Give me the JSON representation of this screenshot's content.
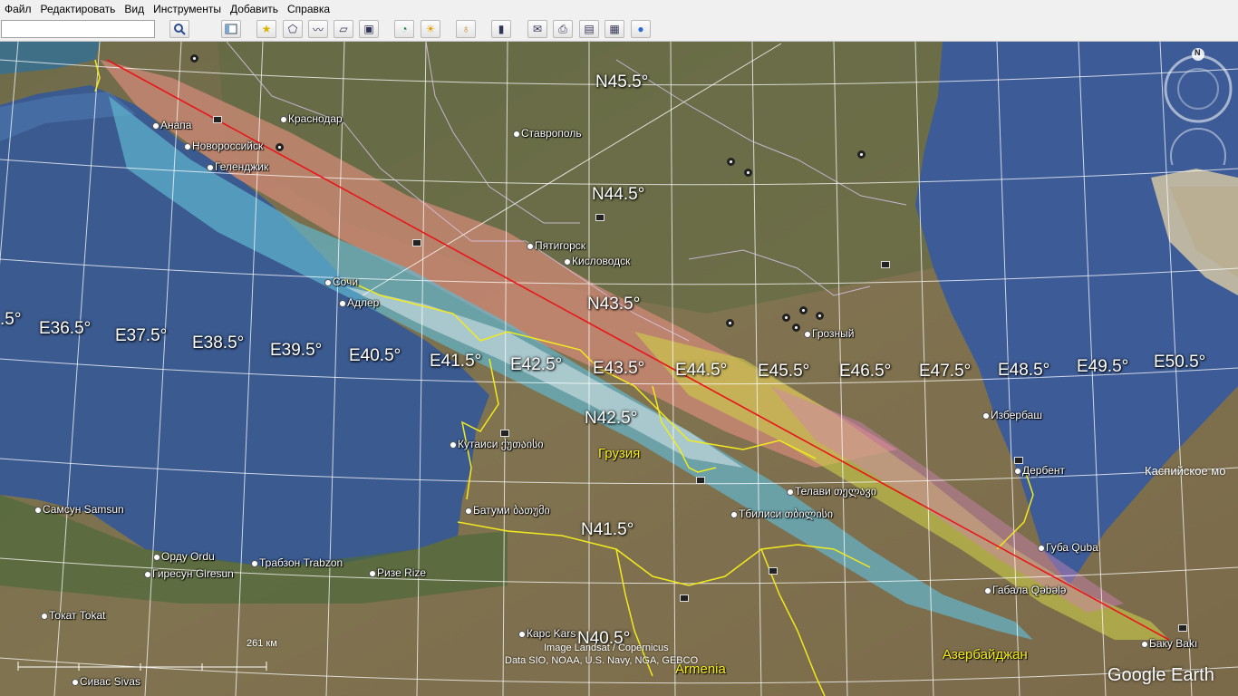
{
  "menu": [
    "Файл",
    "Редактировать",
    "Вид",
    "Инструменты",
    "Добавить",
    "Справка"
  ],
  "search": {
    "value": "",
    "placeholder": ""
  },
  "toolbar_icons": [
    "search-icon",
    "sidebar-icon",
    "placemark-icon",
    "polygon-icon",
    "path-icon",
    "overlay-icon",
    "tour-icon",
    "history-icon",
    "sunlight-icon",
    "planet-icon",
    "ruler-icon",
    "email-icon",
    "print-icon",
    "save-image-icon",
    "map-icon",
    "globe-icon"
  ],
  "grid": {
    "lat": [
      "N45.5°",
      "N44.5°",
      "N43.5°",
      "N42.5°",
      "N41.5°",
      "N40.5°"
    ],
    "lon": [
      ".5°",
      "E36.5°",
      "E37.5°",
      "E38.5°",
      "E39.5°",
      "E40.5°",
      "E41.5°",
      "E42.5°",
      "E43.5°",
      "E44.5°",
      "E45.5°",
      "E46.5°",
      "E47.5°",
      "E48.5°",
      "E49.5°",
      "E50.5°"
    ]
  },
  "cities": [
    "Краснодар",
    "Анапа",
    "Новороссийск",
    "Геленджик",
    "Ставрополь",
    "Пятигорск",
    "Кисловодск",
    "Сочи",
    "Адлер",
    "Грозный",
    "Избербаш",
    "Дербент",
    "Кутаиси ქუთაისი",
    "Телави თელავი",
    "Тбилиси თბილისი",
    "Батуми ბათუმი",
    "Губа Quba",
    "Габала Qəbələ",
    "Баку Bakı",
    "Самсун Samsun",
    "Орду Ordu",
    "Гиресун Giresun",
    "Трабзон Trabzon",
    "Ризе Rize",
    "Токат Tokat",
    "Карс Kars",
    "Сивас Sivas"
  ],
  "countries": [
    "Грузия",
    "Азербайджан",
    "Armenia"
  ],
  "sea": "Каспийское мо",
  "scale": "261 км",
  "credits": [
    "Image Landsat / Copernicus",
    "Data SIO, NOAA, U.S. Navy, NGA, GEBCO"
  ],
  "brand": "Google Earth",
  "compass": "N",
  "colors": {
    "path": "#e8161a",
    "borders": "#f2ea1e",
    "sea": "#3a5a90"
  }
}
